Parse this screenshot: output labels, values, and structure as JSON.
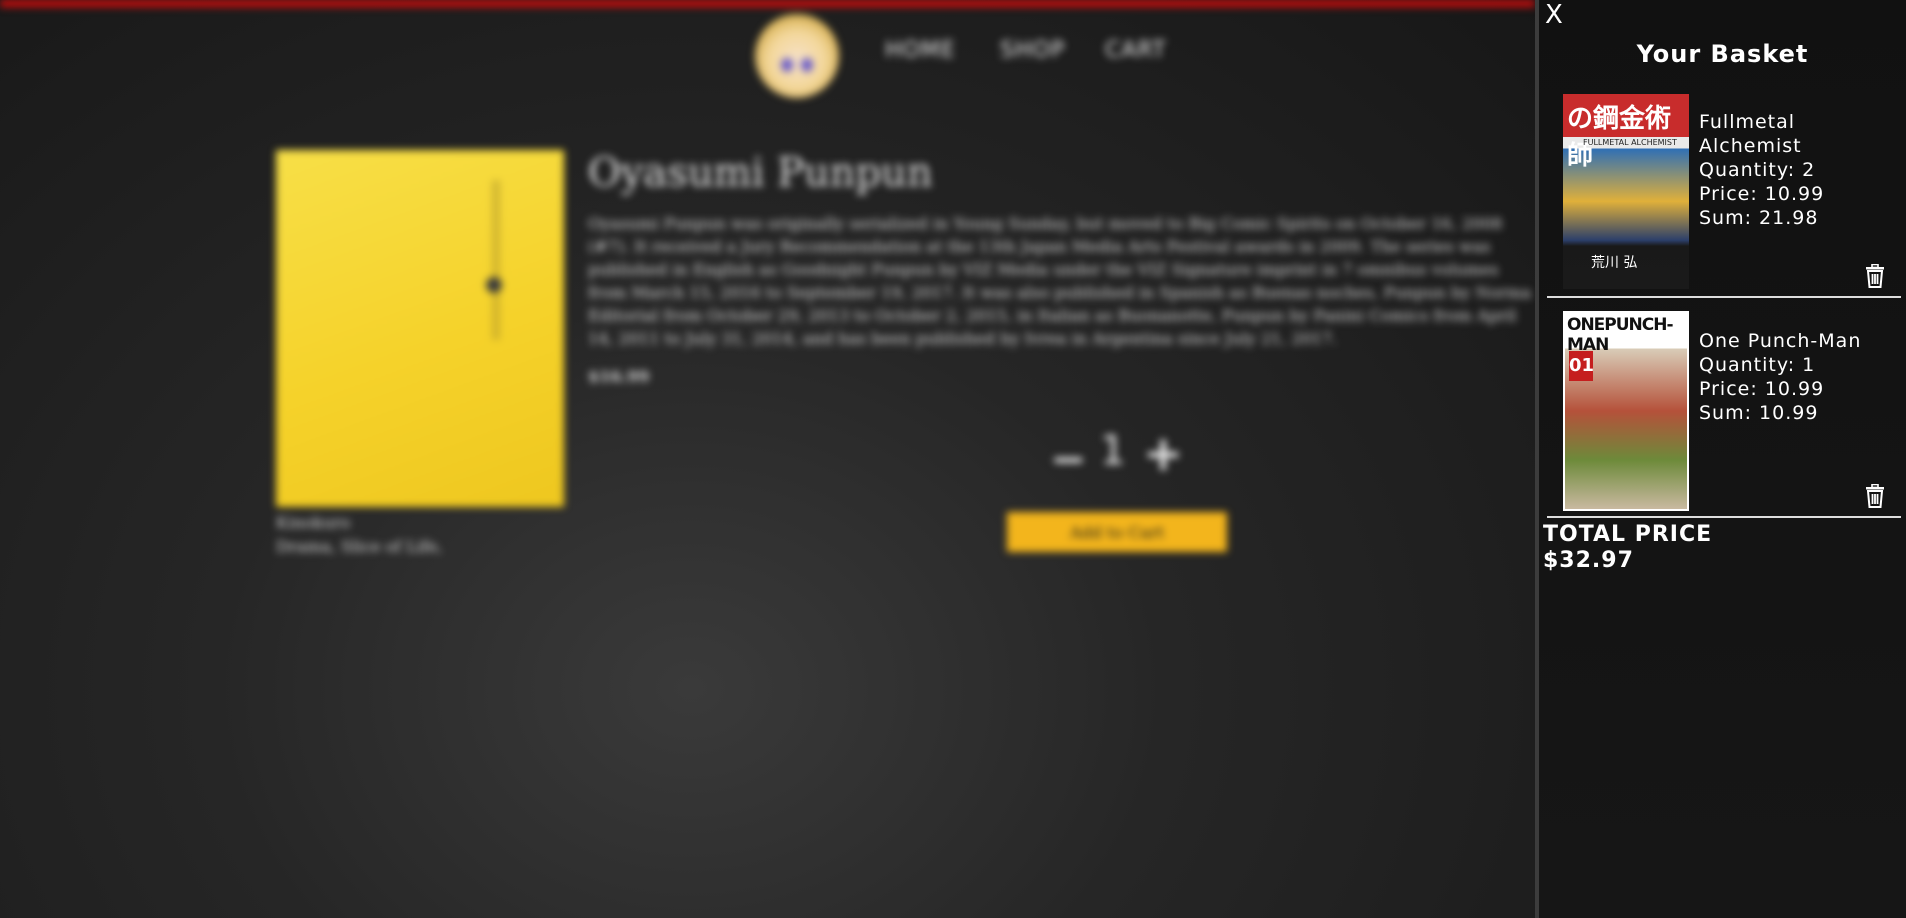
{
  "nav": {
    "items": [
      "HOME",
      "SHOP",
      "CART"
    ]
  },
  "product": {
    "title": "Oyasumi Punpun",
    "description": "Oyasumi Punpun was originally serialized in Young Sunday, but moved to Big Comic Spirits on October 16, 2008 (#7). It received a Jury Recommendation at the 13th Japan Media Arts Festival awards in 2009. The series was published in English as Goodnight Punpun by VIZ Media under the VIZ Signature imprint in 7 omnibus volumes from March 15, 2016 to September 19, 2017. It was also published in Spanish as Buenas noches, Punpun by Norma Editorial from October 29, 2013 to October 2, 2015, in Italian as Buonanotte, Punpun by Panini Comics from April 14, 2011 to July 31, 2014, and has been published by Ivrea in Argentina since July 21, 2017.",
    "price": "$16.99",
    "author": "Kinokuro",
    "genres": "Drama, Slice of Life,",
    "quantity": "1",
    "add_to_cart": "Add to Cart"
  },
  "basket": {
    "close": "X",
    "title": "Your Basket",
    "items": [
      {
        "cover_text": "の鋼金術師",
        "cover_subtitle": "FULLMETAL ALCHEMIST",
        "cover_author": "荒川 弘",
        "name": "Fullmetal Alchemist",
        "quantity": "Quantity: 2",
        "price": "Price: 10.99",
        "sum": "Sum: 21.98"
      },
      {
        "cover_text": "ONEPUNCH-MAN",
        "cover_volume": "01",
        "name": "One Punch-Man",
        "quantity": "Quantity: 1",
        "price": "Price: 10.99",
        "sum": "Sum: 10.99"
      }
    ],
    "total_label": "TOTAL PRICE",
    "total_value": "$32.97"
  },
  "colors": {
    "accent": "#f3b51c",
    "top_bar": "#d40b0b",
    "panel_bg": "#111111"
  },
  "icons": {
    "trash": "trash-icon",
    "close": "close-icon"
  }
}
